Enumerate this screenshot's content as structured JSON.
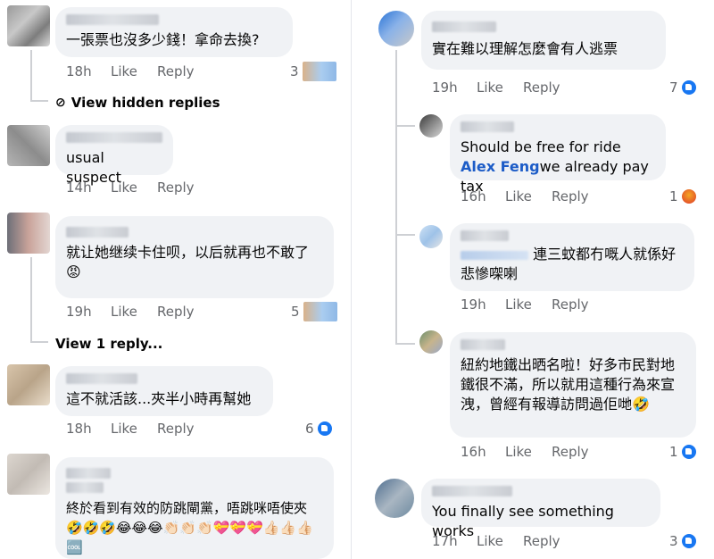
{
  "left": {
    "comments": [
      {
        "text": "一張票也沒多少錢！拿命去換?",
        "time": "18h",
        "like": "Like",
        "reply": "Reply",
        "count": "3"
      },
      {
        "text": "usual suspect",
        "time": "14h",
        "like": "Like",
        "reply": "Reply"
      },
      {
        "text": "就让她继续卡住呗，以后就再也不敢了😡",
        "time": "19h",
        "like": "Like",
        "reply": "Reply",
        "count": "5"
      },
      {
        "text": "這不就活該...夾半小時再幫她",
        "time": "18h",
        "like": "Like",
        "reply": "Reply",
        "count": "6"
      },
      {
        "text": "終於看到有效的防跳閘黨，唔跳咪唔使夾🤣🤣🤣😂😂😂👏🏻👏🏻👏🏻💝💝💝👍🏻👍🏻👍🏻🆒",
        "time": "",
        "like": "",
        "reply": ""
      }
    ],
    "view_hidden": "View hidden replies",
    "view_one": "View 1 reply..."
  },
  "right": {
    "comments": [
      {
        "text": "實在難以理解怎麼會有人逃票",
        "time": "19h",
        "like": "Like",
        "reply": "Reply",
        "count": "7"
      },
      {
        "text": "Should be free for ride",
        "mention": "Alex Feng",
        "text2": "we already pay tax",
        "time": "16h",
        "like": "Like",
        "reply": "Reply",
        "count": "1"
      },
      {
        "text": "連三蚊都冇嘅人就係好悲慘㗎喇",
        "time": "19h",
        "like": "Like",
        "reply": "Reply"
      },
      {
        "text": "紐約地鐵出晒名啦！好多市民對地鐵很不滿，所以就用這種行為來宣洩，曾經有報導訪問過佢哋🤣",
        "time": "16h",
        "like": "Like",
        "reply": "Reply",
        "count": "1"
      },
      {
        "text": "You finally see something works",
        "time": "17h",
        "like": "Like",
        "reply": "Reply",
        "count": "3"
      }
    ]
  },
  "icons": {
    "like": "like-reaction-icon",
    "angry": "angry-reaction-icon",
    "eye": "eye-slash-icon"
  },
  "colors": {
    "link_blue": "#1c5cc7",
    "like_blue": "#1877f2",
    "bubble": "#f0f2f5"
  }
}
